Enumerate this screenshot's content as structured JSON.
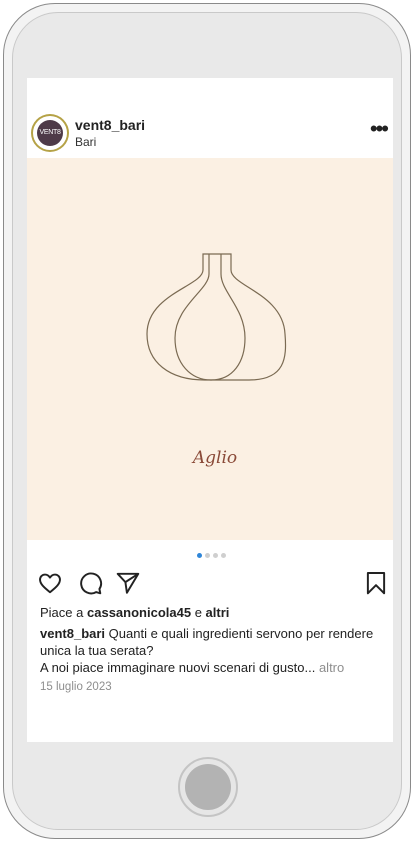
{
  "post": {
    "username": "vent8_bari",
    "location": "Bari",
    "avatar_text": "VENT8",
    "more_icon": "•••",
    "image": {
      "item_name": "Aglio",
      "illustration": "garlic-bulb",
      "background": "#fbf0e3"
    },
    "carousel": {
      "total": 4,
      "active": 1
    },
    "likes": {
      "prefix": "Piace a",
      "user": "cassanonicola45",
      "joiner": "e",
      "others": "altri"
    },
    "caption": {
      "user": "vent8_bari",
      "line1": "Quanti e quali ingredienti servono per rendere unica la tua serata?",
      "line2": "A noi piace immaginare nuovi scenari di gusto...",
      "more": "altro"
    },
    "date": "15 luglio 2023"
  },
  "icons": {
    "like": "heart-icon",
    "comment": "comment-icon",
    "share": "send-icon",
    "save": "bookmark-icon"
  },
  "colors": {
    "accent_dot": "#2f86d8",
    "item_name": "#8a4a38",
    "secondary_text": "#8e8e8e"
  }
}
